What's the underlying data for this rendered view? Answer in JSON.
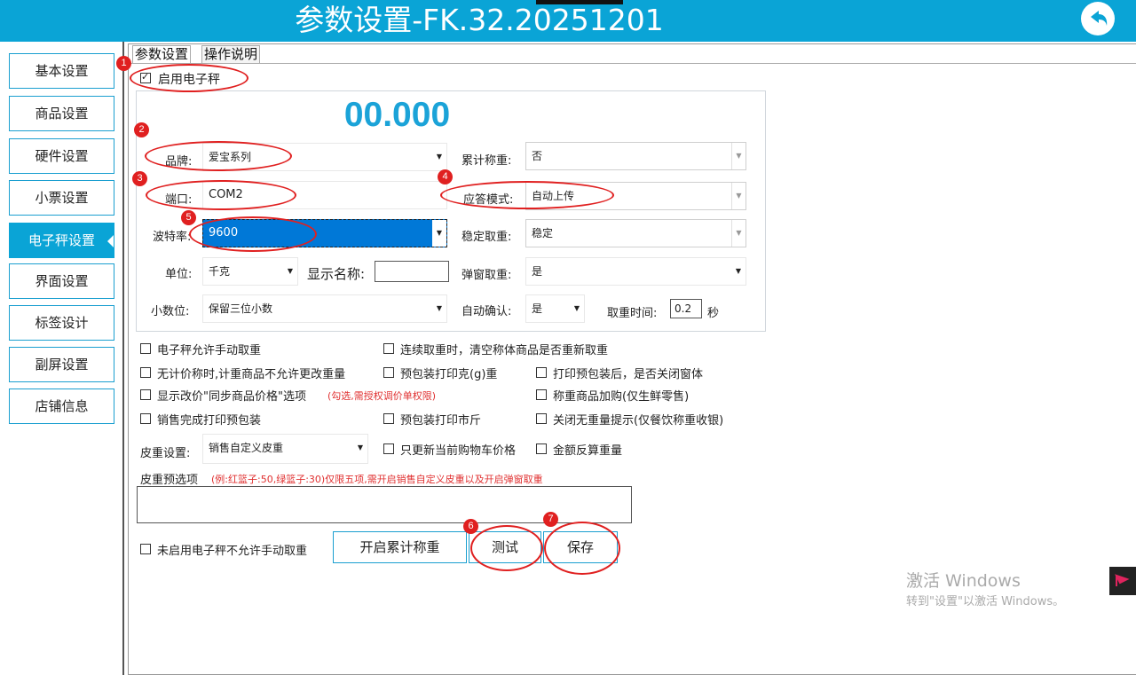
{
  "window": {
    "title": "参数设置-FK.32.20251201"
  },
  "sidebar": {
    "items": [
      {
        "label": "基本设置",
        "active": false
      },
      {
        "label": "商品设置",
        "active": false
      },
      {
        "label": "硬件设置",
        "active": false
      },
      {
        "label": "小票设置",
        "active": false
      },
      {
        "label": "电子秤设置",
        "active": true
      },
      {
        "label": "界面设置",
        "active": false
      },
      {
        "label": "标签设计",
        "active": false
      },
      {
        "label": "副屏设置",
        "active": false
      },
      {
        "label": "店铺信息",
        "active": false
      }
    ]
  },
  "tabs": [
    {
      "label": "参数设置",
      "active": true
    },
    {
      "label": "操作说明",
      "active": false
    }
  ],
  "scale": {
    "enable_label": "启用电子秤",
    "enabled": true,
    "weight_display": "00.000",
    "brand": {
      "label": "品牌:",
      "value": "爱宝系列"
    },
    "port": {
      "label": "端口:",
      "value": "COM2"
    },
    "baud": {
      "label": "波特率:",
      "value": "9600"
    },
    "unit": {
      "label": "单位:",
      "value": "千克"
    },
    "display_name": {
      "label": "显示名称:",
      "value": ""
    },
    "decimals": {
      "label": "小数位:",
      "value": "保留三位小数"
    },
    "cumulative": {
      "label": "累计称重:",
      "value": "否"
    },
    "response_mode": {
      "label": "应答模式:",
      "value": "自动上传"
    },
    "stable": {
      "label": "稳定取重:",
      "value": "稳定"
    },
    "popup": {
      "label": "弹窗取重:",
      "value": "是"
    },
    "auto_confirm": {
      "label": "自动确认:",
      "value": "是"
    },
    "take_time": {
      "label": "取重时间:",
      "value": "0.2",
      "unit": "秒"
    }
  },
  "options": {
    "allow_manual": "电子秤允许手动取重",
    "continuous_clear": "连续取重时，清空称体商品是否重新取重",
    "no_pricing": "无计价称时,计重商品不允许更改重量",
    "prepack_gram": "预包装打印克(g)重",
    "close_after_prepack": "打印预包装后，是否关闭窗体",
    "show_sync": "显示改价\"同步商品价格\"选项",
    "show_sync_note": "(勾选,需授权调价单权限)",
    "weigh_add": "称重商品加购(仅生鲜零售)",
    "print_after_sale": "销售完成打印预包装",
    "prepack_jin": "预包装打印市斤",
    "close_no_weight": "关闭无重量提示(仅餐饮称重收银)"
  },
  "tare": {
    "label": "皮重设置:",
    "value": "销售自定义皮重",
    "only_update_cart": "只更新当前购物车价格",
    "reverse_calc": "金额反算重量",
    "preset_label": "皮重预选项",
    "preset_note": "(例:红篮子:50,绿篮子:30)仅限五项,需开启销售自定义皮重以及开启弹窗取重"
  },
  "footer": {
    "not_enabled_no_manual": "未启用电子秤不允许手动取重",
    "start_cumulative_button": "开启累计称重",
    "test_button": "测试",
    "save_button": "保存"
  },
  "badges": [
    "1",
    "2",
    "3",
    "4",
    "5",
    "6",
    "7"
  ],
  "watermark": {
    "line1": "激活 Windows",
    "line2": "转到\"设置\"以激活 Windows。"
  },
  "colors": {
    "title_bar": "#0aa4d6",
    "accent": "#1ba3d8",
    "selection": "#0078d7",
    "annotation": "#e02020"
  }
}
